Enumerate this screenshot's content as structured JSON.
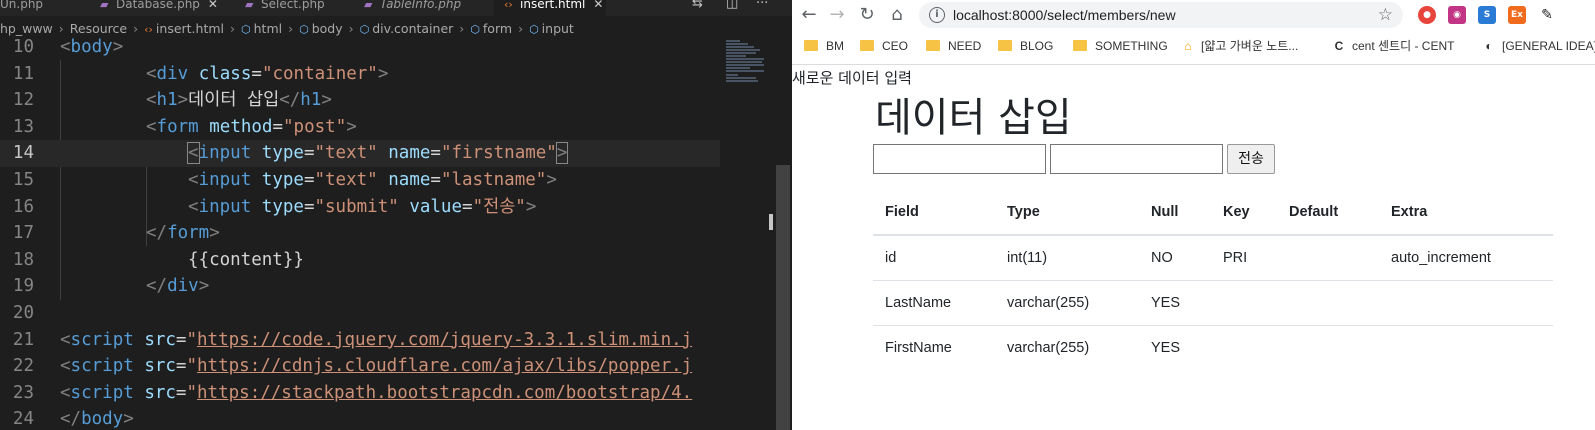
{
  "editor": {
    "tabs": [
      {
        "label": "Un.php",
        "type": "php",
        "active": false
      },
      {
        "label": "Database.php",
        "type": "php",
        "active": false
      },
      {
        "label": "Select.php",
        "type": "php",
        "active": false
      },
      {
        "label": "TableInfo.php",
        "type": "php",
        "active": false
      },
      {
        "label": "insert.html",
        "type": "html",
        "active": true
      }
    ],
    "breadcrumb": [
      "hp_www",
      "Resource",
      "insert.html",
      "html",
      "body",
      "div.container",
      "form",
      "input"
    ],
    "line_numbers": [
      "10",
      "11",
      "12",
      "13",
      "14",
      "15",
      "16",
      "17",
      "18",
      "19",
      "20",
      "21",
      "22",
      "23",
      "24"
    ],
    "current_line": "14",
    "code": {
      "l10": "body",
      "l11_tag": "div",
      "l11_attr": "class",
      "l11_val": "\"container\"",
      "l12_tag": "h1",
      "l12_text": "데이터 삽입",
      "l12_close": "h1",
      "l13_tag": "form",
      "l13_attr": "method",
      "l13_val": "\"post\"",
      "l14_tag": "input",
      "l14_attr1": "type",
      "l14_val1": "\"text\"",
      "l14_attr2": "name",
      "l14_val2": "\"firstname\"",
      "l15_tag": "input",
      "l15_attr1": "type",
      "l15_val1": "\"text\"",
      "l15_attr2": "name",
      "l15_val2": "\"lastname\"",
      "l16_tag": "input",
      "l16_attr1": "type",
      "l16_val1": "\"submit\"",
      "l16_attr2": "value",
      "l16_val2": "\"전송\"",
      "l17_tag": "form",
      "l18_text": "{{content}}",
      "l19_tag": "div",
      "l21_tag": "script",
      "l21_attr": "src",
      "l21_url": "https://code.jquery.com/jquery-3.3.1.slim.min.j",
      "l22_tag": "script",
      "l22_attr": "src",
      "l22_url": "https://cdnjs.cloudflare.com/ajax/libs/popper.j",
      "l23_tag": "script",
      "l23_attr": "src",
      "l23_url": "https://stackpath.bootstrapcdn.com/bootstrap/4.",
      "l24_tag": "body"
    }
  },
  "browser": {
    "url": "localhost:8000/select/members/new",
    "bookmarks": [
      {
        "label": "BM",
        "icon": "folder"
      },
      {
        "label": "CEO",
        "icon": "folder"
      },
      {
        "label": "NEED",
        "icon": "folder"
      },
      {
        "label": "BLOG",
        "icon": "folder"
      },
      {
        "label": "SOMETHING",
        "icon": "folder"
      },
      {
        "label": "[얇고 가벼운 노트...",
        "icon": "home"
      },
      {
        "label": "cent 센트디 - CENT",
        "icon": "c"
      },
      {
        "label": "[GENERAL IDEA]",
        "icon": "circle"
      }
    ],
    "extensions": [
      {
        "name": "red-extension-icon",
        "color": "#e8453c"
      },
      {
        "name": "instagram-extension-icon",
        "color": "#c13584"
      },
      {
        "name": "blue-extension-icon",
        "color": "#2a7bd5"
      },
      {
        "name": "orange-extension-icon",
        "color": "#f26b1d"
      }
    ]
  },
  "page": {
    "note": "새로운 데이터 입력",
    "title": "데이터 삽입",
    "submit_label": "전송",
    "table": {
      "headers": [
        "Field",
        "Type",
        "Null",
        "Key",
        "Default",
        "Extra"
      ],
      "rows": [
        [
          "id",
          "int(11)",
          "NO",
          "PRI",
          "",
          "auto_increment"
        ],
        [
          "LastName",
          "varchar(255)",
          "YES",
          "",
          "",
          ""
        ],
        [
          "FirstName",
          "varchar(255)",
          "YES",
          "",
          "",
          ""
        ]
      ]
    }
  }
}
